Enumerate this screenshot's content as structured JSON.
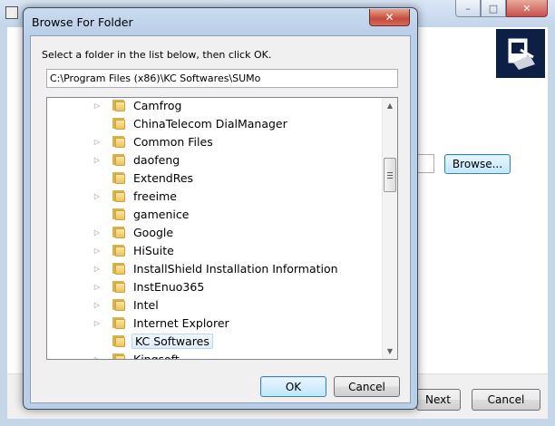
{
  "background_window": {
    "buttons": {
      "browse": "Browse...",
      "next": "Next",
      "cancel": "Cancel"
    },
    "caption": {
      "minimize": "–",
      "maximize": "□",
      "close": "✕"
    }
  },
  "dialog": {
    "title": "Browse For Folder",
    "close_glyph": "✕",
    "instruction": "Select a folder in the list below, then click OK.",
    "path": "C:\\Program Files (x86)\\KC Softwares\\SUMo",
    "buttons": {
      "ok": "OK",
      "cancel": "Cancel"
    },
    "folders": [
      {
        "label": "Camfrog",
        "expandable": true,
        "selected": false
      },
      {
        "label": "ChinaTelecom DialManager",
        "expandable": false,
        "selected": false
      },
      {
        "label": "Common Files",
        "expandable": true,
        "selected": false
      },
      {
        "label": "daofeng",
        "expandable": true,
        "selected": false
      },
      {
        "label": "ExtendRes",
        "expandable": false,
        "selected": false
      },
      {
        "label": "freeime",
        "expandable": true,
        "selected": false
      },
      {
        "label": "gamenice",
        "expandable": false,
        "selected": false
      },
      {
        "label": "Google",
        "expandable": true,
        "selected": false
      },
      {
        "label": "HiSuite",
        "expandable": true,
        "selected": false
      },
      {
        "label": "InstallShield Installation Information",
        "expandable": true,
        "selected": false
      },
      {
        "label": "InstEnuo365",
        "expandable": true,
        "selected": false
      },
      {
        "label": "Intel",
        "expandable": true,
        "selected": false
      },
      {
        "label": "Internet Explorer",
        "expandable": true,
        "selected": false
      },
      {
        "label": "KC Softwares",
        "expandable": false,
        "selected": true
      },
      {
        "label": "Kingsoft",
        "expandable": true,
        "selected": false
      }
    ],
    "scroll_arrows": {
      "up": "▲",
      "down": "▼"
    },
    "expander_glyph": "▷"
  }
}
